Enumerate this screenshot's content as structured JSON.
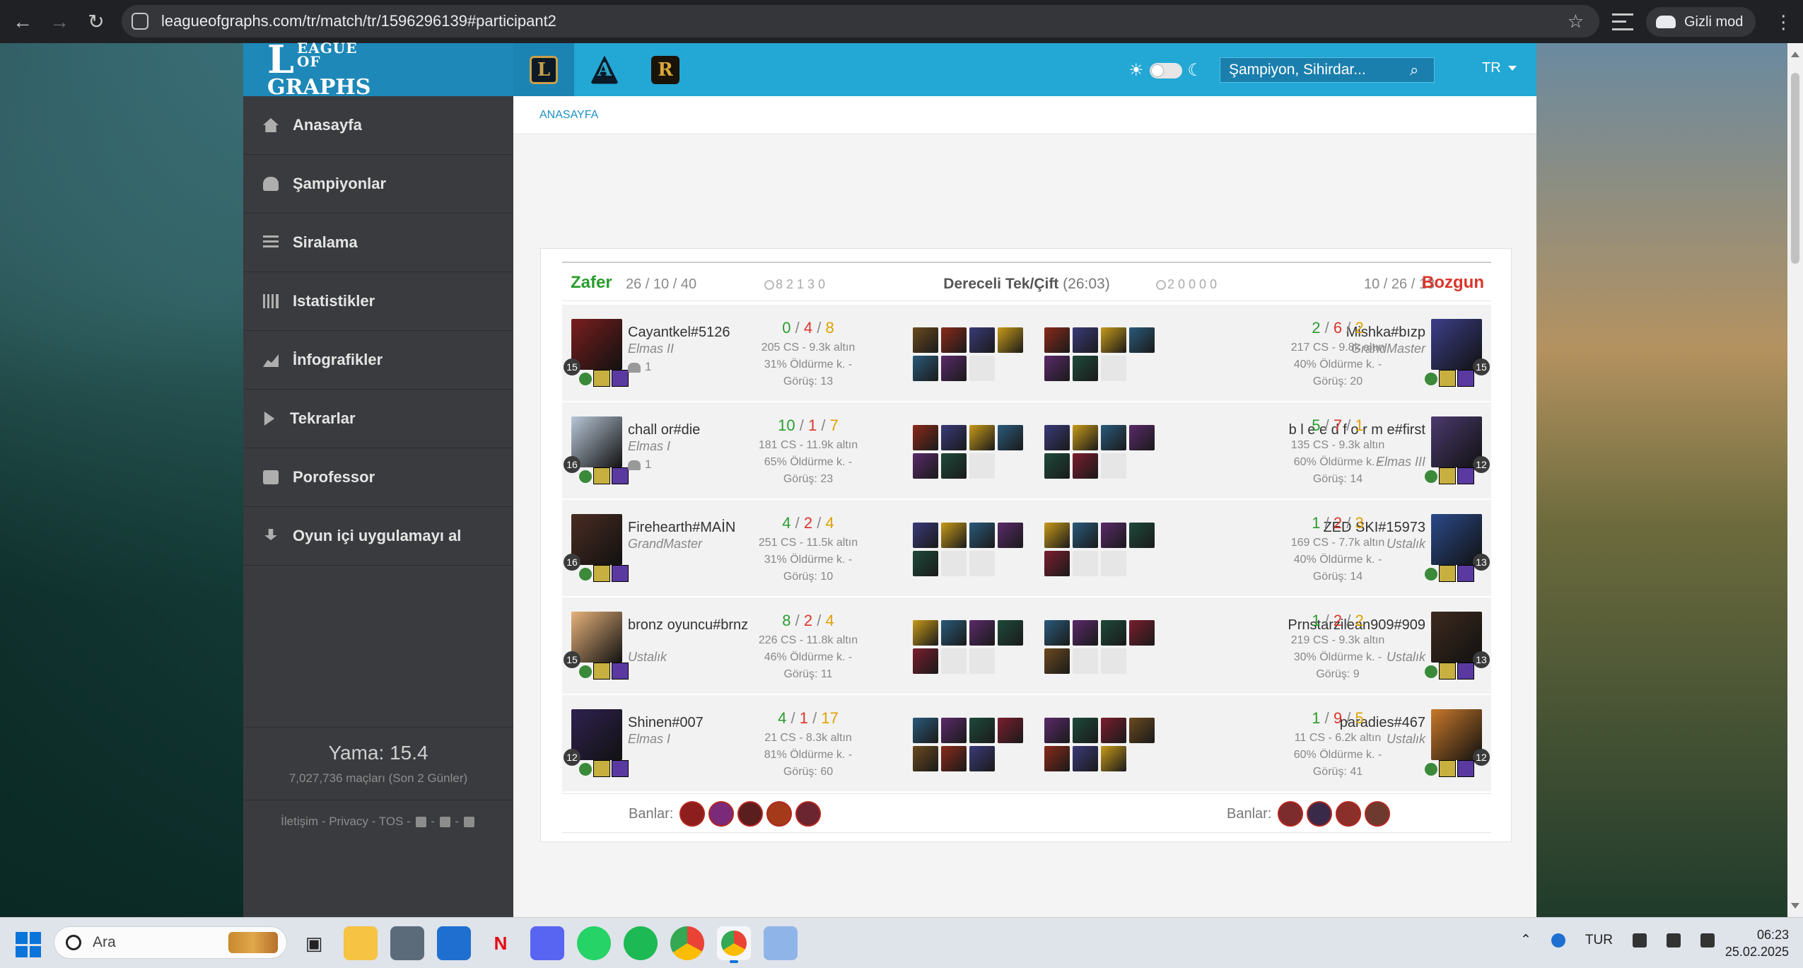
{
  "browser": {
    "url": "leagueofgraphs.com/tr/match/tr/1596296139#participant2",
    "profile_label": "Gizli mod",
    "back_icon": "arrow-left-icon",
    "forward_icon": "arrow-right-icon",
    "reload_icon": "reload-icon"
  },
  "site": {
    "logo_line1": "EAGUE OF",
    "logo_line2": "GRAPHS",
    "logo_initial": "L",
    "game_tabs": [
      {
        "label": "L",
        "name": "League of Legends"
      },
      {
        "label": "A",
        "name": "TFT"
      },
      {
        "label": "R",
        "name": "Legends of Runeterra"
      }
    ],
    "search_placeholder": "Şampiyon, Sihirdar...",
    "language": "TR",
    "colors": {
      "header": "#23a7d4",
      "win": "#2a9d2f",
      "loss": "#d9362b",
      "assists": "#e0a100"
    }
  },
  "sidebar": {
    "items": [
      {
        "label": "Anasayfa",
        "icon": "home-icon"
      },
      {
        "label": "Şampiyonlar",
        "icon": "users-icon"
      },
      {
        "label": "Siralama",
        "icon": "list-icon"
      },
      {
        "label": "Istatistikler",
        "icon": "bar-chart-icon"
      },
      {
        "label": "İnfografikler",
        "icon": "area-chart-icon"
      },
      {
        "label": "Tekrarlar",
        "icon": "play-icon"
      },
      {
        "label": "Porofessor",
        "icon": "print-icon"
      },
      {
        "label": "Oyun içi uygulamayı al",
        "icon": "download-icon"
      }
    ],
    "patch_title": "Yama: 15.4",
    "patch_sub": "7,027,736 maçları (Son 2 Günler)",
    "links": {
      "contact": "İletişim",
      "privacy": "Privacy",
      "tos": "TOS",
      "sep": "-"
    }
  },
  "breadcrumb": "ANASAYFA",
  "match": {
    "win_label": "Zafer",
    "win_kda": "26 / 10 / 40",
    "win_objectives": "8 2 1 3 0",
    "queue": "Dereceli Tek/Çift",
    "duration": "(26:03)",
    "loss_objectives": "2 0 0 0 0",
    "loss_kda": "10 / 26 / 13",
    "loss_label": "Bozgun",
    "rows": [
      {
        "left": {
          "name": "Cayantkel#5126",
          "rank": "Elmas II",
          "party": "1",
          "level": "15",
          "k": "0",
          "d": "4",
          "a": "8",
          "cs": "205 CS - 9.3k altın",
          "kp": "31% Öldürme k. -",
          "vision": "Görüş: 13"
        },
        "right": {
          "name": "Mishka#bızp",
          "rank": "GrandMaster",
          "party": "",
          "level": "15",
          "k": "2",
          "d": "6",
          "a": "2",
          "cs": "217 CS - 9.8k altın",
          "kp": "40% Öldürme k. -",
          "vision": "Görüş: 20"
        }
      },
      {
        "left": {
          "name": "chall or#die",
          "rank": "Elmas I",
          "party": "1",
          "level": "16",
          "k": "10",
          "d": "1",
          "a": "7",
          "cs": "181 CS - 11.9k altın",
          "kp": "65% Öldürme k. -",
          "vision": "Görüş: 23"
        },
        "right": {
          "name": "b l e e d  f o r m e#first",
          "rank": "Elmas III",
          "party": "",
          "level": "12",
          "k": "5",
          "d": "7",
          "a": "1",
          "cs": "135 CS - 9.3k altın",
          "kp": "60% Öldürme k. -",
          "vision": "Görüş: 14"
        }
      },
      {
        "left": {
          "name": "Firehearth#MAİN",
          "rank": "GrandMaster",
          "party": "",
          "level": "16",
          "k": "4",
          "d": "2",
          "a": "4",
          "cs": "251 CS - 11.5k altın",
          "kp": "31% Öldürme k. -",
          "vision": "Görüş: 10"
        },
        "right": {
          "name": "ZED SKI#15973",
          "rank": "Ustalık",
          "party": "",
          "level": "13",
          "k": "1",
          "d": "2",
          "a": "3",
          "cs": "169 CS - 7.7k altın",
          "kp": "40% Öldürme k. -",
          "vision": "Görüş: 14"
        }
      },
      {
        "left": {
          "name": "bronz oyuncu#brnz",
          "rank": "Ustalık",
          "party": "",
          "level": "15",
          "k": "8",
          "d": "2",
          "a": "4",
          "cs": "226 CS - 11.8k altın",
          "kp": "46% Öldürme k. -",
          "vision": "Görüş: 11"
        },
        "right": {
          "name": "Prnstarzilean909#909",
          "rank": "Ustalık",
          "party": "",
          "level": "13",
          "k": "1",
          "d": "2",
          "a": "2",
          "cs": "219 CS - 9.3k altın",
          "kp": "30% Öldürme k. -",
          "vision": "Görüş: 9"
        }
      },
      {
        "left": {
          "name": "Shinen#007",
          "rank": "Elmas I",
          "party": "",
          "level": "12",
          "k": "4",
          "d": "1",
          "a": "17",
          "cs": "21 CS - 8.3k altın",
          "kp": "81% Öldürme k. -",
          "vision": "Görüş: 60"
        },
        "right": {
          "name": "paradies#467",
          "rank": "Ustalık",
          "party": "",
          "level": "12",
          "k": "1",
          "d": "9",
          "a": "5",
          "cs": "11 CS - 6.2k altın",
          "kp": "60% Öldürme k. -",
          "vision": "Görüş: 41"
        }
      }
    ],
    "bans_label": "Banlar:"
  },
  "taskbar": {
    "search_text": "Ara",
    "lang": "TUR",
    "time": "06:23",
    "date": "25.02.2025"
  }
}
